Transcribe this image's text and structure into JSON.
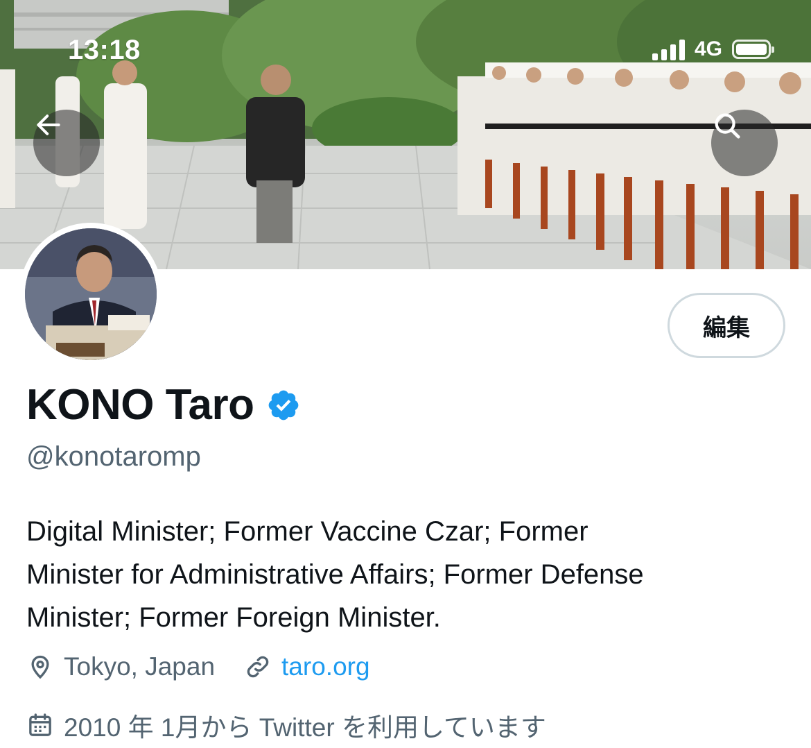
{
  "status_bar": {
    "time": "13:18",
    "network": "4G",
    "signal_icon": "cellular-signal-icon",
    "battery_icon": "battery-icon"
  },
  "header": {
    "back_icon": "arrow-left-icon",
    "search_icon": "search-icon"
  },
  "profile": {
    "display_name": "KONO Taro",
    "verified_icon": "verified-badge-icon",
    "handle": "@konotaromp",
    "edit_label": "編集",
    "bio_lines": [
      "Digital Minister; Former Vaccine Czar; Former",
      "Minister for Administrative Affairs; Former Defense",
      "Minister; Former Foreign Minister."
    ],
    "location": "Tokyo, Japan",
    "location_icon": "location-pin-icon",
    "website": "taro.org",
    "website_icon": "link-icon",
    "joined": "2010 年 1月から Twitter を利用しています",
    "joined_icon": "calendar-icon"
  },
  "colors": {
    "accent": "#1d9bf0",
    "text": "#0f1419",
    "secondary": "#536471",
    "border": "#cfd9de"
  }
}
